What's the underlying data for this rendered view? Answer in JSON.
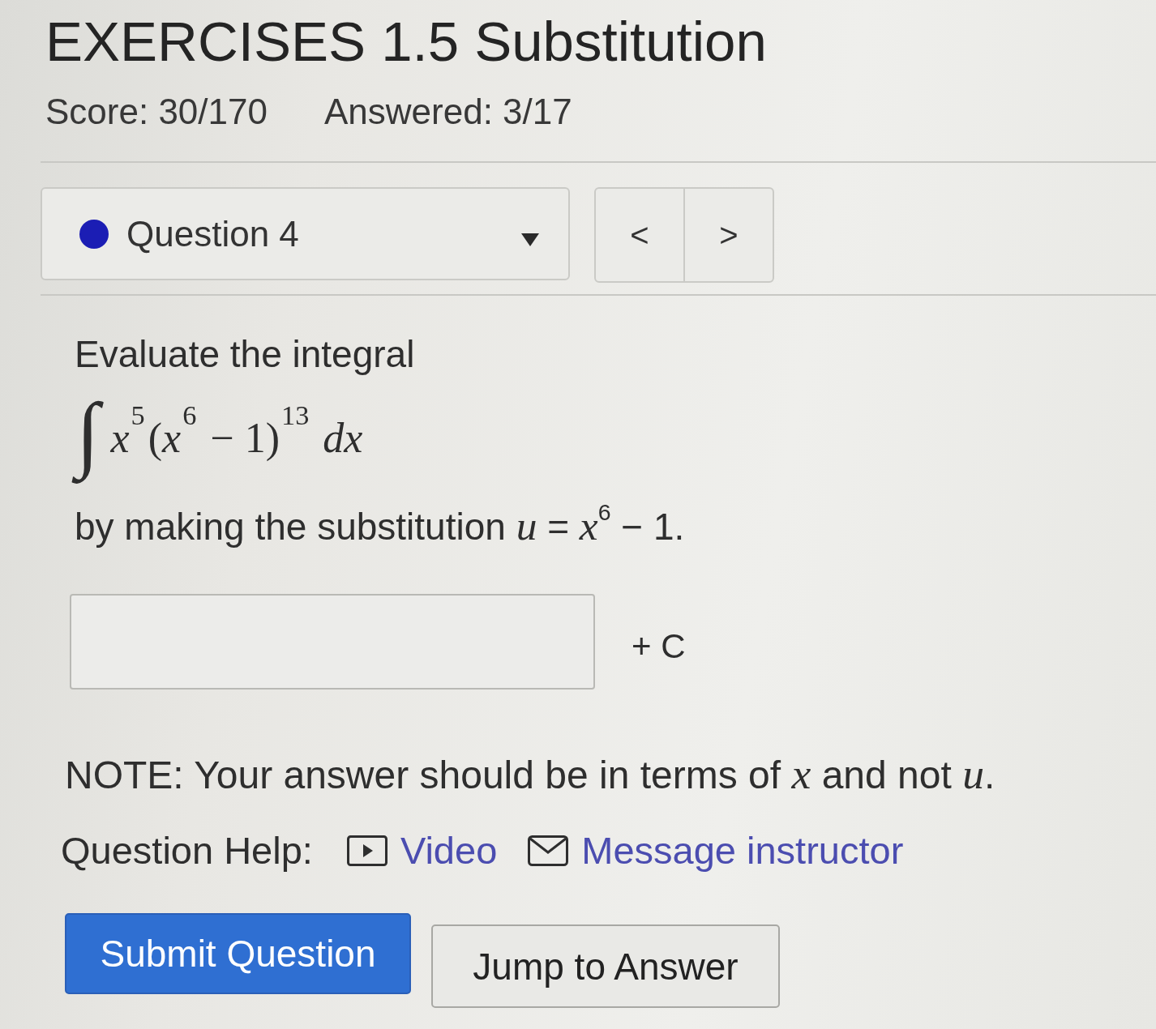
{
  "header": {
    "title": "EXERCISES 1.5 Substitution",
    "score": "Score: 30/170",
    "answered": "Answered: 3/17"
  },
  "question_nav": {
    "current": {
      "label": "Question 4",
      "color": "#1b1db4"
    },
    "prev": "<",
    "next": ">"
  },
  "question": {
    "prompt": "Evaluate the integral",
    "integral": {
      "sign": "∫",
      "integrand": "*x*$^{5}$(*x*$^{6}$ − 1)$^{13}$ *dx*"
    },
    "substitution": "by making the substitution *u* = *x*$^{6}$ − 1.",
    "answer": {
      "suffix": "+ C"
    },
    "note": "NOTE: Your answer should be in terms of *x* and not *u*."
  },
  "help": {
    "label": "Question Help:",
    "links": [
      {
        "kind": "video",
        "label": "Video"
      },
      {
        "kind": "message",
        "label": "Message instructor"
      }
    ]
  },
  "buttons": [
    {
      "kind": "primary",
      "label": "Submit Question"
    },
    {
      "kind": "secondary",
      "label": "Jump to Answer"
    }
  ]
}
